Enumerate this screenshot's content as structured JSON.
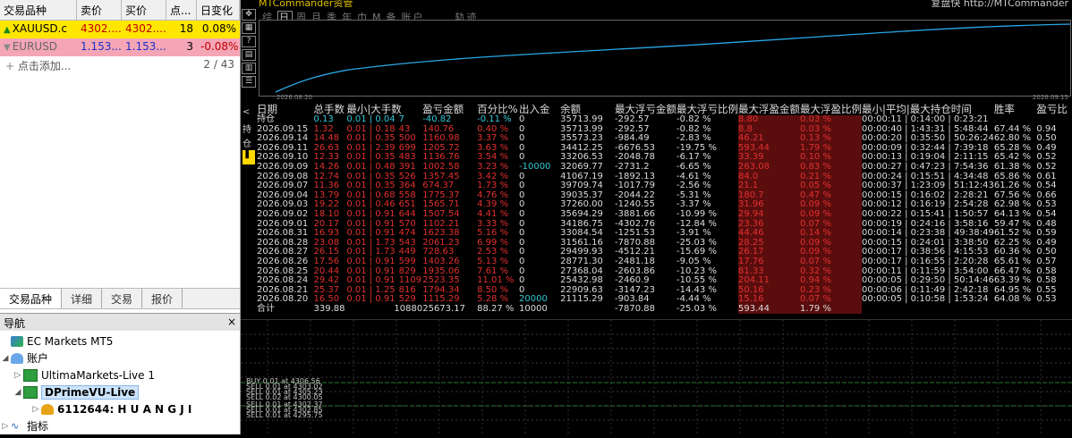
{
  "market_watch": {
    "columns": [
      "交易品种",
      "卖价",
      "买价",
      "点...",
      "日变化"
    ],
    "rows": [
      {
        "symbol": "XAUUSD.c",
        "bid": "4302....",
        "ask": "4302....",
        "points": "18",
        "change": "0.08%",
        "direction": "up"
      },
      {
        "symbol": "EURUSD",
        "bid": "1.153...",
        "ask": "1.153...",
        "points": "3",
        "change": "-0.08%",
        "direction": "down"
      }
    ],
    "add_label": "点击添加...",
    "count": "2 / 43",
    "tabs": [
      "交易品种",
      "详细",
      "交易",
      "报价"
    ]
  },
  "navigator": {
    "title": "导航",
    "close": "×",
    "root": "EC Markets MT5",
    "accounts_label": "账户",
    "servers": [
      "UltimaMarkets-Live 1",
      "DPrimeVU-Live"
    ],
    "account": "6112644: H U A N G J I",
    "indicators": "指标"
  },
  "terminal": {
    "title": "MTCommander资管",
    "right_title": "复盘快 http://MTCommander",
    "periods": [
      "综",
      "日",
      "周",
      "月",
      "季",
      "年",
      "巾",
      "M",
      "备",
      "账户",
      "轨迹"
    ],
    "active_period": "日",
    "chart_start": "2026.08.20",
    "chart_end": "2026.09.15",
    "left_tabs": [
      "<",
      "持",
      "仓"
    ],
    "headers": [
      "日期",
      "总手数",
      "最小|大手数",
      "盈亏金额",
      "百分比%",
      "出入金",
      "余额",
      "最大浮亏金额",
      "最大浮亏比例",
      "最大浮盈金额",
      "最大浮盈比例",
      "最小|平均|最大持仓时间",
      "胜率",
      "盈亏比"
    ],
    "holding": {
      "label": "持仓",
      "lots": "0.13",
      "minmax": "0.01 | 0.04",
      "count": "7",
      "pnl": "-40.82",
      "pct": "-0.11 %",
      "dep": "0",
      "bal": "35713.99",
      "mfe": "-292.57",
      "mfep": "-0.82 %",
      "mae": "8.80",
      "maep": "0.03 %",
      "time": "00:00:11 | 0:14:00 | 0:23:21",
      "win": "",
      "pf": ""
    },
    "rows": [
      {
        "date": "2026.09.15",
        "lots": "1.32",
        "minmax": "0.01 | 0.18",
        "count": "43",
        "pnl": "140.76",
        "pct": "0.40 %",
        "dep": "0",
        "bal": "35713.99",
        "mfe": "-292.57",
        "mfep": "-0.82 %",
        "mae": "8.8",
        "maep": "0.03 %",
        "time": "00:00:40 | 1:43:31 | 5:48:44",
        "win": "67.44 %",
        "pf": "0.94"
      },
      {
        "date": "2026.09.14",
        "lots": "14.48",
        "minmax": "0.01 | 0.35",
        "count": "500",
        "pnl": "1160.98",
        "pct": "3.37 %",
        "dep": "0",
        "bal": "35573.23",
        "mfe": "-984.49",
        "mfep": "-2.83 %",
        "mae": "46.21",
        "maep": "0.13 %",
        "time": "00:00:20 | 0:35:50 | 50:26:24",
        "win": "62.80 %",
        "pf": "0.50"
      },
      {
        "date": "2026.09.11",
        "lots": "26.63",
        "minmax": "0.01 | 2.39",
        "count": "699",
        "pnl": "1205.72",
        "pct": "3.63 %",
        "dep": "0",
        "bal": "34412.25",
        "mfe": "-6676.53",
        "mfep": "-19.75 %",
        "mae": "593.44",
        "maep": "1.79 %",
        "time": "00:00:09 | 0:32:44 | 7:39:18",
        "win": "65.28 %",
        "pf": "0.49"
      },
      {
        "date": "2026.09.10",
        "lots": "12.33",
        "minmax": "0.01 | 0.35",
        "count": "483",
        "pnl": "1136.76",
        "pct": "3.54 %",
        "dep": "0",
        "bal": "33206.53",
        "mfe": "-2048.78",
        "mfep": "-6.17 %",
        "mae": "33.39",
        "maep": "0.10 %",
        "time": "00:00:13 | 0:19:04 | 2:11:15",
        "win": "65.42 %",
        "pf": "0.52"
      },
      {
        "date": "2026.09.09",
        "lots": "14.26",
        "minmax": "0.01 | 0.48",
        "count": "391",
        "pnl": "1002.58",
        "pct": "3.23 %",
        "dep": "-10000",
        "bal": "32069.77",
        "mfe": "-2731.2",
        "mfep": "-6.65 %",
        "mae": "263.08",
        "maep": "0.83 %",
        "time": "00:00:27 | 0:47:23 | 7:54:36",
        "win": "61.38 %",
        "pf": "0.52"
      },
      {
        "date": "2026.09.08",
        "lots": "12.74",
        "minmax": "0.01 | 0.35",
        "count": "526",
        "pnl": "1357.45",
        "pct": "3.42 %",
        "dep": "0",
        "bal": "41067.19",
        "mfe": "-1892.13",
        "mfep": "-4.61 %",
        "mae": "84.0",
        "maep": "0.21 %",
        "time": "00:00:24 | 0:15:51 | 4:34:48",
        "win": "65.86 %",
        "pf": "0.61"
      },
      {
        "date": "2026.09.07",
        "lots": "11.36",
        "minmax": "0.01 | 0.35",
        "count": "364",
        "pnl": "674.37",
        "pct": "1.73 %",
        "dep": "0",
        "bal": "39709.74",
        "mfe": "-1017.79",
        "mfep": "-2.56 %",
        "mae": "21.1",
        "maep": "0.05 %",
        "time": "00:00:37 | 1:23:09 | 51:12:43",
        "win": "61.26 %",
        "pf": "0.54"
      },
      {
        "date": "2026.09.04",
        "lots": "13.79",
        "minmax": "0.01 | 0.68",
        "count": "558",
        "pnl": "1775.37",
        "pct": "4.76 %",
        "dep": "0",
        "bal": "39035.37",
        "mfe": "-2044.22",
        "mfep": "-5.31 %",
        "mae": "180.7",
        "maep": "0.47 %",
        "time": "00:00:15 | 0:16:02 | 2:28:21",
        "win": "67.56 %",
        "pf": "0.66"
      },
      {
        "date": "2026.09.03",
        "lots": "19.22",
        "minmax": "0.01 | 0.46",
        "count": "651",
        "pnl": "1565.71",
        "pct": "4.39 %",
        "dep": "0",
        "bal": "37260.00",
        "mfe": "-1240.55",
        "mfep": "-3.37 %",
        "mae": "31.96",
        "maep": "0.09 %",
        "time": "00:00:12 | 0:16:19 | 2:54:28",
        "win": "62.98 %",
        "pf": "0.53"
      },
      {
        "date": "2026.09.02",
        "lots": "18.10",
        "minmax": "0.01 | 0.91",
        "count": "644",
        "pnl": "1507.54",
        "pct": "4.41 %",
        "dep": "0",
        "bal": "35694.29",
        "mfe": "-3881.66",
        "mfep": "-10.99 %",
        "mae": "29.94",
        "maep": "0.09 %",
        "time": "00:00:22 | 0:15:41 | 1:50:57",
        "win": "64.13 %",
        "pf": "0.54"
      },
      {
        "date": "2026.09.01",
        "lots": "20.17",
        "minmax": "0.01 | 0.91",
        "count": "570",
        "pnl": "1102.21",
        "pct": "3.33 %",
        "dep": "0",
        "bal": "34186.75",
        "mfe": "-4302.76",
        "mfep": "-12.84 %",
        "mae": "23.36",
        "maep": "0.07 %",
        "time": "00:00:19 | 0:24:16 | 3:58:16",
        "win": "59.47 %",
        "pf": "0.48"
      },
      {
        "date": "2026.08.31",
        "lots": "16.93",
        "minmax": "0.01 | 0.91",
        "count": "474",
        "pnl": "1623.38",
        "pct": "5.16 %",
        "dep": "0",
        "bal": "33084.54",
        "mfe": "-1251.53",
        "mfep": "-3.91 %",
        "mae": "44.46",
        "maep": "0.14 %",
        "time": "00:00:14 | 0:23:38 | 49:38:49",
        "win": "61.52 %",
        "pf": "0.59"
      },
      {
        "date": "2026.08.28",
        "lots": "23.08",
        "minmax": "0.01 | 1.73",
        "count": "543",
        "pnl": "2061.23",
        "pct": "6.99 %",
        "dep": "0",
        "bal": "31561.16",
        "mfe": "-7870.88",
        "mfep": "-25.03 %",
        "mae": "28.25",
        "maep": "0.09 %",
        "time": "00:00:15 | 0:24:01 | 3:38:50",
        "win": "62.25 %",
        "pf": "0.49"
      },
      {
        "date": "2026.08.27",
        "lots": "26.15",
        "minmax": "0.01 | 1.73",
        "count": "449",
        "pnl": "728.63",
        "pct": "2.53 %",
        "dep": "0",
        "bal": "29499.93",
        "mfe": "-4512.21",
        "mfep": "-15.69 %",
        "mae": "26.17",
        "maep": "0.09 %",
        "time": "00:00:17 | 0:38:56 | 4:15:53",
        "win": "60.36 %",
        "pf": "0.50"
      },
      {
        "date": "2026.08.26",
        "lots": "17.56",
        "minmax": "0.01 | 0.91",
        "count": "599",
        "pnl": "1403.26",
        "pct": "5.13 %",
        "dep": "0",
        "bal": "28771.30",
        "mfe": "-2481.18",
        "mfep": "-9.05 %",
        "mae": "17.76",
        "maep": "0.07 %",
        "time": "00:00:17 | 0:16:55 | 2:20:28",
        "win": "65.61 %",
        "pf": "0.57"
      },
      {
        "date": "2026.08.25",
        "lots": "20.44",
        "minmax": "0.01 | 0.91",
        "count": "829",
        "pnl": "1935.06",
        "pct": "7.61 %",
        "dep": "0",
        "bal": "27368.04",
        "mfe": "-2603.86",
        "mfep": "-10.23 %",
        "mae": "81.33",
        "maep": "0.32 %",
        "time": "00:00:11 | 0:11:59 | 3:54:00",
        "win": "66.47 %",
        "pf": "0.58"
      },
      {
        "date": "2026.08.24",
        "lots": "29.42",
        "minmax": "0.01 | 0.91",
        "count": "1109",
        "pnl": "2523.35",
        "pct": "11.01 %",
        "dep": "0",
        "bal": "25432.98",
        "mfe": "-2460.9",
        "mfep": "-10.55 %",
        "mae": "204.11",
        "maep": "0.94 %",
        "time": "00:00:05 | 0:29:50 | 50:14:46",
        "win": "63.39 %",
        "pf": "0.58"
      },
      {
        "date": "2026.08.21",
        "lots": "25.37",
        "minmax": "0.01 | 1.25",
        "count": "816",
        "pnl": "1794.34",
        "pct": "8.50 %",
        "dep": "0",
        "bal": "22909.63",
        "mfe": "-3147.23",
        "mfep": "-14.43 %",
        "mae": "50.16",
        "maep": "0.23 %",
        "time": "00:00:06 | 0:11:49 | 2:42:18",
        "win": "64.95 %",
        "pf": "0.55"
      },
      {
        "date": "2026.08.20",
        "lots": "16.50",
        "minmax": "0.01 | 0.91",
        "count": "529",
        "pnl": "1115.29",
        "pct": "5.28 %",
        "dep": "20000",
        "bal": "21115.29",
        "mfe": "-903.84",
        "mfep": "-4.44 %",
        "mae": "15.16",
        "maep": "0.07 %",
        "time": "00:00:05 | 0:10:58 | 1:53:24",
        "win": "64.08 %",
        "pf": "0.53"
      }
    ],
    "total": {
      "label": "合计",
      "lots": "339.88",
      "count": "10880",
      "pnl": "25673.17",
      "pct": "88.27 %",
      "dep": "10000",
      "mfe": "-7870.88",
      "mfep": "-25.03 %",
      "mae": "593.44",
      "maep": "1.79 %"
    },
    "orders": [
      "BUY 0.01 at 4306.56",
      "SELL 0.01 at 4303.02",
      "SELL 0.01 at 4305.23",
      "SELL 0.02 at 4300.05",
      "SELL 0.01 at 4302.37",
      "SELL 0.01 at 4302.85",
      "SELL 0.01 at 4295.75"
    ]
  },
  "colors": {
    "accent_yellow": "#ffe600",
    "curve": "#2aa7e6",
    "negative": "#e23030",
    "cyan": "#33c8d6"
  }
}
